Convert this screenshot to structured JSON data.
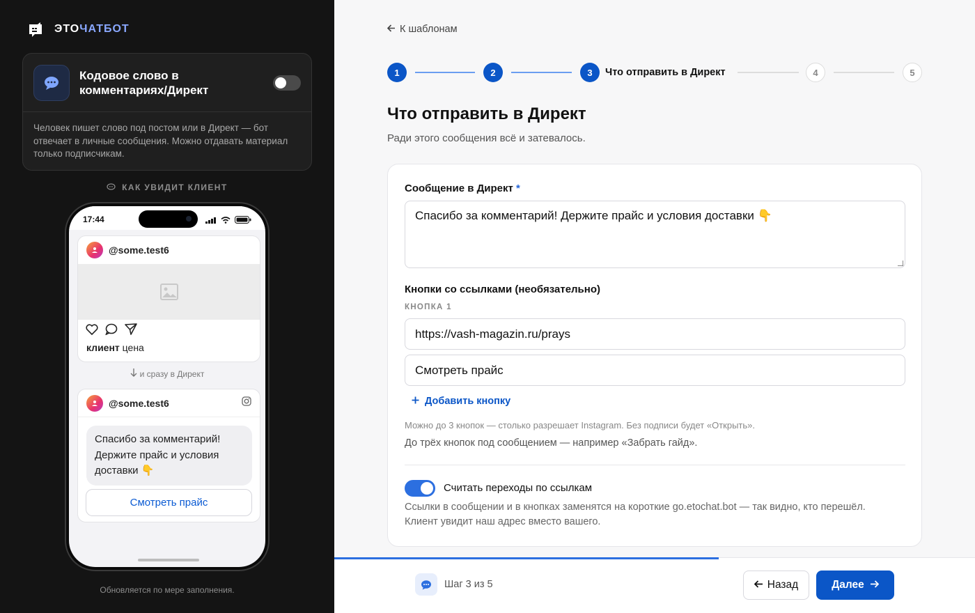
{
  "brand": {
    "part1": "ЭТО",
    "part2": "ЧАТБОТ",
    "accent_color": "#8aa8ff"
  },
  "feature_card": {
    "title": "Кодовое слово в комментариях/Директ",
    "enabled": false,
    "description": "Человек пишет слово под постом или в Директ — бот отвечает в личные сообщения. Можно отдавать материал только подписчикам."
  },
  "preview": {
    "label": "КАК УВИДИТ КЛИЕНТ",
    "phone_time": "17:44",
    "post": {
      "handle": "@some.test6",
      "caption_user": "клиент",
      "caption_text": "цена"
    },
    "flow_note": "и сразу в Директ",
    "dm": {
      "handle": "@some.test6",
      "message": "Спасибо за комментарий! Держите прайс и условия доставки 👇",
      "button": "Смотреть прайс"
    },
    "footer": "Обновляется по мере заполнения."
  },
  "nav": {
    "back": "К шаблонам"
  },
  "stepper": {
    "steps": [
      {
        "n": "1",
        "state": "done"
      },
      {
        "n": "2",
        "state": "done"
      },
      {
        "n": "3",
        "state": "current",
        "label": "Что отправить в Директ"
      },
      {
        "n": "4",
        "state": "todo"
      },
      {
        "n": "5",
        "state": "todo"
      }
    ]
  },
  "page": {
    "title": "Что отправить в Директ",
    "subtitle": "Ради этого сообщения всё и затевалось."
  },
  "form": {
    "message_label": "Сообщение в Директ",
    "required_mark": "*",
    "message_value": "Спасибо за комментарий! Держите прайс и условия доставки 👇",
    "buttons_label": "Кнопки со ссылками (необязательно)",
    "button1_label": "КНОПКА 1",
    "button1_url": "https://vash-magazin.ru/prays",
    "button1_text": "Смотреть прайс",
    "add_button": "Добавить кнопку",
    "hint_limit": "Можно до 3 кнопок — столько разрешает Instagram. Без подписи будет «Открыть».",
    "hint_example": "До трёх кнопок под сообщением — например «Забрать гайд».",
    "track_toggle_label": "Считать переходы по ссылкам",
    "track_enabled": true,
    "track_desc": "Ссылки в сообщении и в кнопках заменятся на короткие go.etochat.bot — так видно, кто перешёл. Клиент увидит наш адрес вместо вашего."
  },
  "footer": {
    "step_text": "Шаг 3 из 5",
    "progress": 0.6,
    "back": "Назад",
    "next": "Далее"
  },
  "colors": {
    "primary": "#0b56c7",
    "dark_bg": "#141414"
  }
}
